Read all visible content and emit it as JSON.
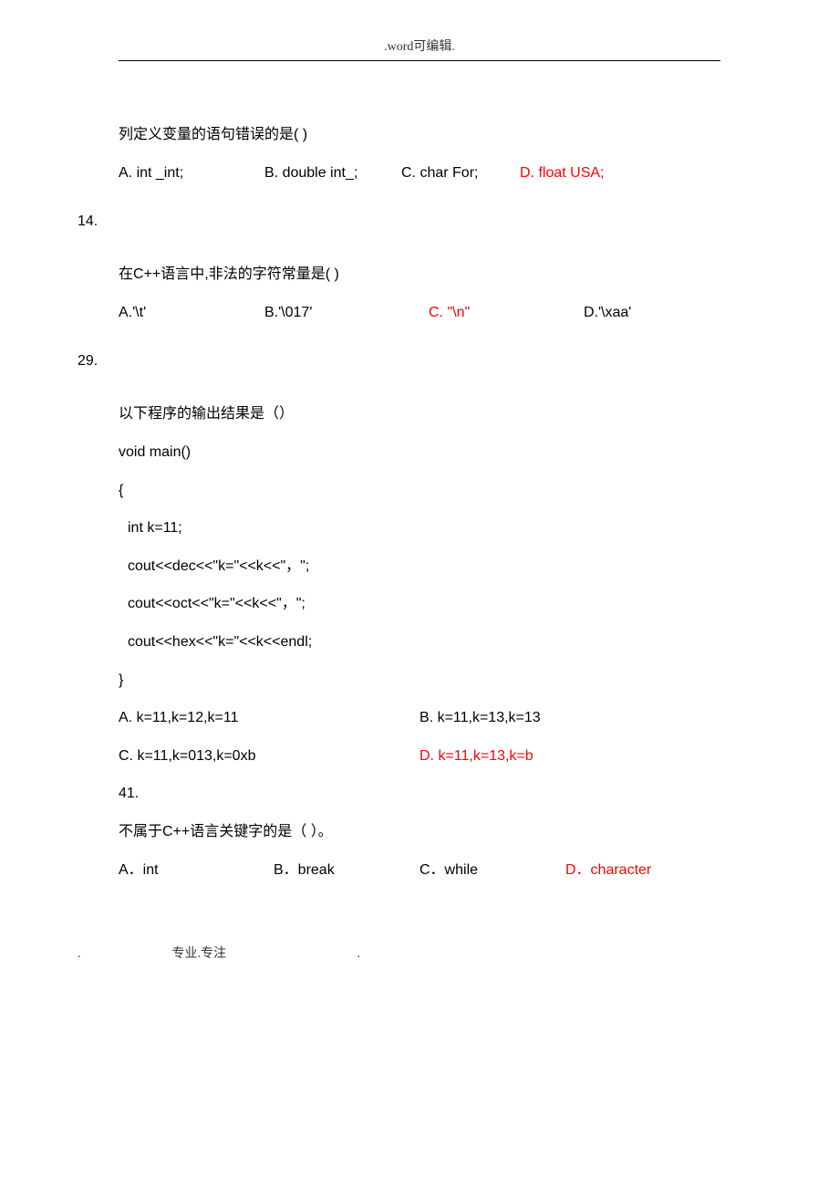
{
  "header": ".word可编辑.",
  "q13": {
    "stem": "列定义变量的语句错误的是(    )",
    "a": "A. int _int;",
    "b": "B. double int_;",
    "c": "C. char For;",
    "d": "D. float USA;"
  },
  "q14": {
    "num": "14.",
    "stem": "在C++语言中,非法的字符常量是(    )",
    "a": "A.'\\t'",
    "b": "B.'\\017'",
    "c": "C. \"\\n\"",
    "d": "D.'\\xaa'"
  },
  "q29": {
    "num": "29.",
    "stem": "以下程序的输出结果是（）",
    "code": {
      "l1": "void main()",
      "l2": "{",
      "l3": "  int k=11;",
      "l4": "  cout<<dec<<\"k=\"<<k<<\"，\";",
      "l5": "  cout<<oct<<\"k=\"<<k<<\"，\";",
      "l6": "  cout<<hex<<\"k=\"<<k<<endl;",
      "l7": "}"
    },
    "a": "A. k=11,k=12,k=11",
    "b": "B. k=11,k=13,k=13",
    "c": "C. k=11,k=013,k=0xb",
    "d": "D. k=11,k=13,k=b"
  },
  "q41": {
    "num": "41.",
    "stem": "不属于C++语言关键字的是（   ）。",
    "a": "A．int",
    "b": "B．break",
    "c": "C．while",
    "d": "D．character"
  },
  "footer": {
    "left": ".",
    "mid": "专业.专注",
    "right": "."
  }
}
